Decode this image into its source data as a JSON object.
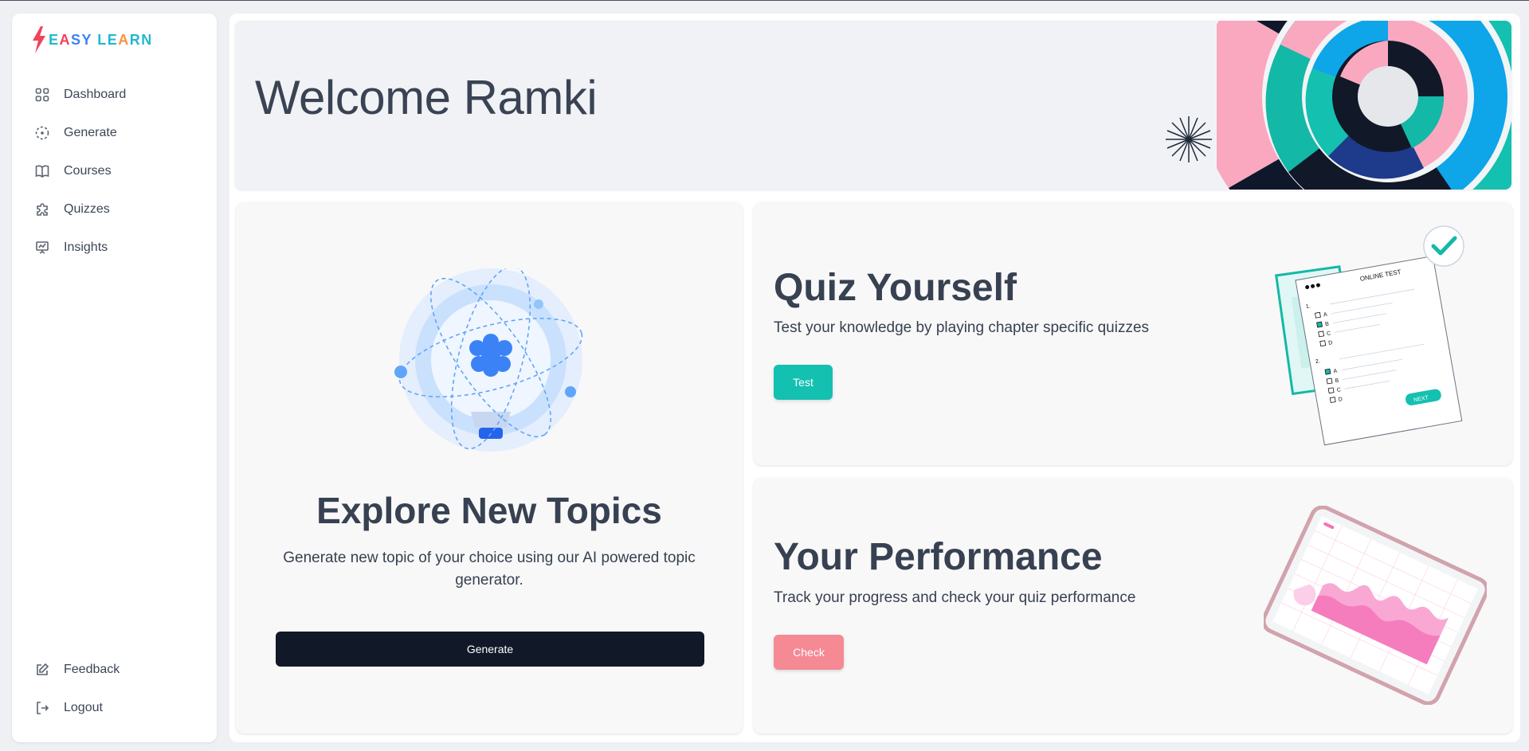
{
  "brand": {
    "name_parts": [
      "E",
      "A",
      "SY ",
      "LE",
      "A",
      "RN"
    ]
  },
  "sidebar": {
    "items": [
      {
        "label": "Dashboard",
        "icon": "grid-icon"
      },
      {
        "label": "Generate",
        "icon": "dashed-circle-icon"
      },
      {
        "label": "Courses",
        "icon": "book-icon"
      },
      {
        "label": "Quizzes",
        "icon": "puzzle-icon"
      },
      {
        "label": "Insights",
        "icon": "presentation-chart-icon"
      }
    ],
    "bottom_items": [
      {
        "label": "Feedback",
        "icon": "edit-icon"
      },
      {
        "label": "Logout",
        "icon": "logout-icon"
      }
    ]
  },
  "hero": {
    "title": "Welcome Ramki"
  },
  "explore": {
    "title": "Explore New Topics",
    "description": "Generate new topic of your choice using our AI powered topic generator.",
    "button": "Generate"
  },
  "quiz": {
    "title": "Quiz Yourself",
    "description": "Test your knowledge by playing chapter specific quizzes",
    "button": "Test",
    "illustration": {
      "header": "ONLINE TEST",
      "options": [
        "A",
        "B",
        "C",
        "D"
      ],
      "next_label": "NEXT"
    }
  },
  "performance": {
    "title": "Your Performance",
    "description": "Track your progress and check your quiz performance",
    "button": "Check"
  },
  "colors": {
    "teal": "#14c0b0",
    "pink": "#f58a94",
    "dark": "#111827"
  }
}
